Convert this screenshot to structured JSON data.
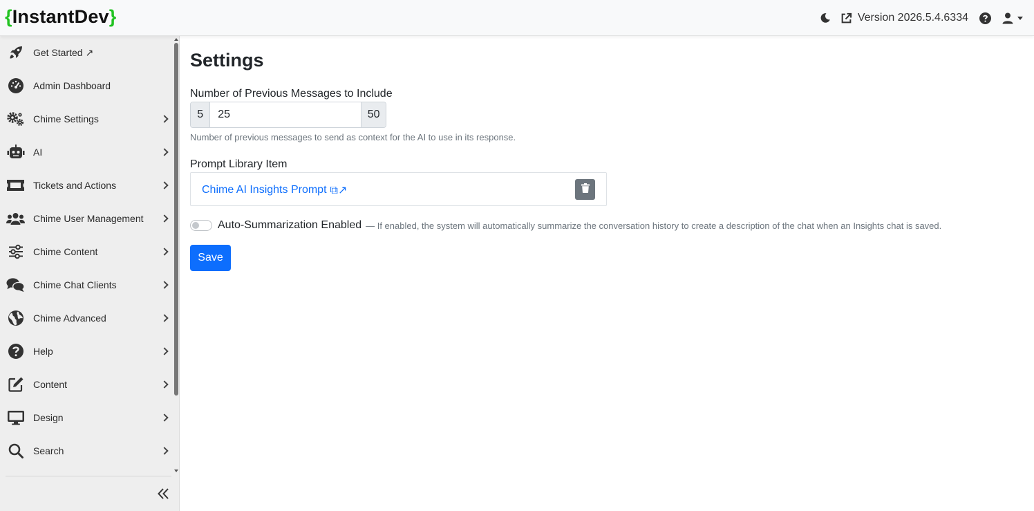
{
  "brand": {
    "open_brace": "{",
    "name": "InstantDev",
    "close_brace": "}"
  },
  "header": {
    "version_label": "Version 2026.5.4.6334",
    "icons": {
      "theme": "moon-icon",
      "external": "external-link-icon",
      "help": "question-circle-icon",
      "user": "user-icon"
    }
  },
  "sidebar": {
    "items": [
      {
        "label": "Get Started ↗",
        "icon": "rocket-icon",
        "has_submenu": false
      },
      {
        "label": "Admin Dashboard",
        "icon": "gauge-icon",
        "has_submenu": false
      },
      {
        "label": "Chime Settings",
        "icon": "gears-icon",
        "has_submenu": true
      },
      {
        "label": "AI",
        "icon": "robot-icon",
        "has_submenu": true
      },
      {
        "label": "Tickets and Actions",
        "icon": "ticket-icon",
        "has_submenu": true
      },
      {
        "label": "Chime User Management",
        "icon": "users-icon",
        "has_submenu": true
      },
      {
        "label": "Chime Content",
        "icon": "sliders-icon",
        "has_submenu": true
      },
      {
        "label": "Chime Chat Clients",
        "icon": "comments-icon",
        "has_submenu": true
      },
      {
        "label": "Chime Advanced",
        "icon": "globe-icon",
        "has_submenu": true
      },
      {
        "label": "Help",
        "icon": "question-circle-icon",
        "has_submenu": true
      },
      {
        "label": "Content",
        "icon": "edit-icon",
        "has_submenu": true
      },
      {
        "label": "Design",
        "icon": "monitor-icon",
        "has_submenu": true
      },
      {
        "label": "Search",
        "icon": "search-icon",
        "has_submenu": true
      }
    ],
    "collapse_icon": "double-chevron-left-icon"
  },
  "main": {
    "title": "Settings",
    "messages_field": {
      "label": "Number of Previous Messages to Include",
      "min": "5",
      "value": "25",
      "max": "50",
      "help": "Number of previous messages to send as context for the AI to use in its response."
    },
    "prompt_field": {
      "label": "Prompt Library Item",
      "link_text": "Chime AI Insights Prompt",
      "link_icon_glyph": "⧉↗"
    },
    "auto_summarization": {
      "label": "Auto-Summarization Enabled",
      "description": "— If enabled, the system will automatically summarize the conversation history to create a description of the chat when an Insights chat is saved.",
      "enabled": false
    },
    "save_label": "Save"
  },
  "colors": {
    "brand_brace": "#22c322",
    "primary": "#0d6efd",
    "secondary": "#6c757d",
    "sidebar_bg": "#eeeeee",
    "navbar_bg": "#f8f9fa"
  }
}
